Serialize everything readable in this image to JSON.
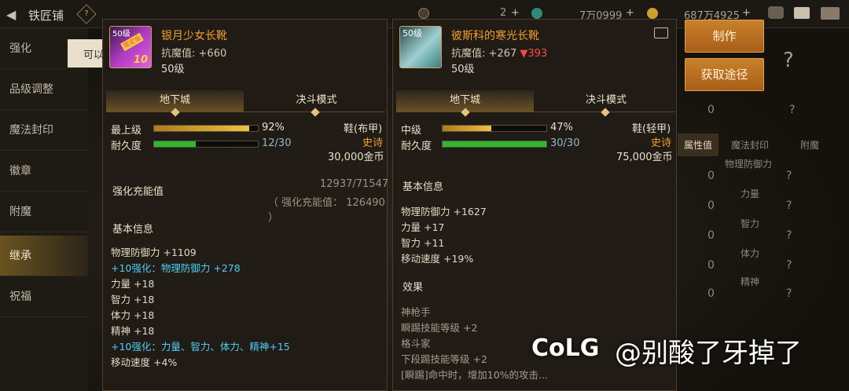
{
  "header": {
    "title": "铁匠铺",
    "help_icon": "?",
    "val1": "2",
    "val2": "7万0999",
    "val3": "687万4925"
  },
  "tooltip": {
    "text": "可以"
  },
  "sidebar": {
    "items": [
      {
        "label": "强化"
      },
      {
        "label": "品级调整"
      },
      {
        "label": "魔法封印"
      },
      {
        "label": "徽章"
      },
      {
        "label": "附魔"
      },
      {
        "label": "继承"
      },
      {
        "label": "祝福"
      }
    ]
  },
  "actions": {
    "make": "制作",
    "source": "获取途径"
  },
  "right": {
    "tab1": "属性值",
    "tab2": "魔法封印",
    "tab3": "附魔",
    "stats": [
      "物理防御力",
      "力量",
      "智力",
      "体力",
      "精神"
    ],
    "zero": "0",
    "q": "?"
  },
  "left_card": {
    "badge": "50级",
    "sticker": "限定版",
    "tag": "10",
    "name": "银月少女长靴",
    "resist_label": "抗魔值:",
    "resist_value": "+660",
    "level": "50级",
    "tab_dungeon": "地下城",
    "tab_duel": "决斗模式",
    "grade_label": "最上级",
    "grade_pct": "92%",
    "grade_fill": 0.92,
    "dur_label": "耐久度",
    "dur_value": "12/30",
    "dur_fill": 0.4,
    "type": "鞋(布甲)",
    "rarity": "史诗",
    "price": "30,000金币",
    "charge_label": "强化充能值",
    "charge_value": "12937/71547",
    "charge_sub": "（ 强化充能值： 126490 ）",
    "basic_label": "基本信息",
    "attrs": [
      {
        "text": "物理防御力 +1109",
        "cls": ""
      },
      {
        "text": "+10强化：物理防御力 +278",
        "cls": "cyan"
      },
      {
        "text": "力量 +18",
        "cls": ""
      },
      {
        "text": "智力 +18",
        "cls": ""
      },
      {
        "text": "体力 +18",
        "cls": ""
      },
      {
        "text": "精神 +18",
        "cls": ""
      },
      {
        "text": "+10强化：力量、智力、体力、精神+15",
        "cls": "cyan"
      },
      {
        "text": "移动速度 +4%",
        "cls": ""
      }
    ]
  },
  "right_card": {
    "badge": "50级",
    "name": "彼斯科的寒光长靴",
    "resist_label": "抗魔值:",
    "resist_value": "+267",
    "resist_diff": "▼393",
    "level": "50级",
    "tab_dungeon": "地下城",
    "tab_duel": "决斗模式",
    "grade_label": "中级",
    "grade_pct": "47%",
    "grade_fill": 0.47,
    "dur_label": "耐久度",
    "dur_value": "30/30",
    "dur_fill": 1.0,
    "type": "鞋(轻甲)",
    "rarity": "史诗",
    "price": "75,000金币",
    "basic_label": "基本信息",
    "attrs": [
      {
        "text": "物理防御力 +1627"
      },
      {
        "text": "力量 +17"
      },
      {
        "text": "智力 +11"
      },
      {
        "text": "移动速度 +19%"
      }
    ],
    "effect_label": "效果",
    "effects": [
      {
        "text": "神枪手"
      },
      {
        "text": "瞬踢技能等级 +2"
      },
      {
        "text": "格斗家"
      },
      {
        "text": "下段踢技能等级 +2"
      },
      {
        "text": "[瞬踢]命中时，增加10%的攻击..."
      }
    ]
  },
  "watermark": {
    "logo": "CoLG",
    "text": "@别酸了牙掉了"
  },
  "colors": {
    "gold": "#e6c37a",
    "orange": "#f0a030",
    "cyan": "#4ecdf5",
    "red": "#ff4848",
    "green": "#3fd43f"
  }
}
